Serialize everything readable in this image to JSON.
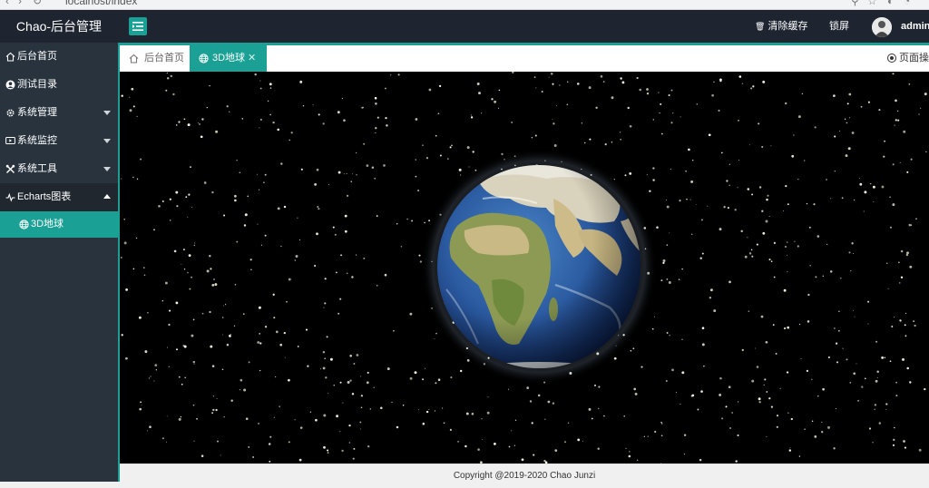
{
  "browser": {
    "url": "localhost/index"
  },
  "header": {
    "logo": "Chao-后台管理",
    "clear_cache": "清除缓存",
    "lock_screen": "锁屏",
    "username": "admin"
  },
  "sidebar": {
    "items": [
      {
        "label": "后台首页",
        "icon": "home-icon"
      },
      {
        "label": "测试目录",
        "icon": "user-circle-icon"
      },
      {
        "label": "系统管理",
        "icon": "gear-icon"
      },
      {
        "label": "系统监控",
        "icon": "monitor-icon"
      },
      {
        "label": "系统工具",
        "icon": "tools-icon"
      },
      {
        "label": "Echarts图表",
        "icon": "pulse-icon"
      }
    ],
    "sub_items": [
      {
        "label": "3D地球",
        "icon": "globe-icon"
      }
    ]
  },
  "tabs": {
    "home": "后台首页",
    "active": "3D地球",
    "close": "✕",
    "page_ops": "页面操作"
  },
  "footer": {
    "copyright": "Copyright @2019-2020 Chao Junzi"
  },
  "colors": {
    "header_bg": "#1e2531",
    "sidebar_bg": "#28333e",
    "accent": "#1aa094",
    "content_bg": "#000000"
  }
}
